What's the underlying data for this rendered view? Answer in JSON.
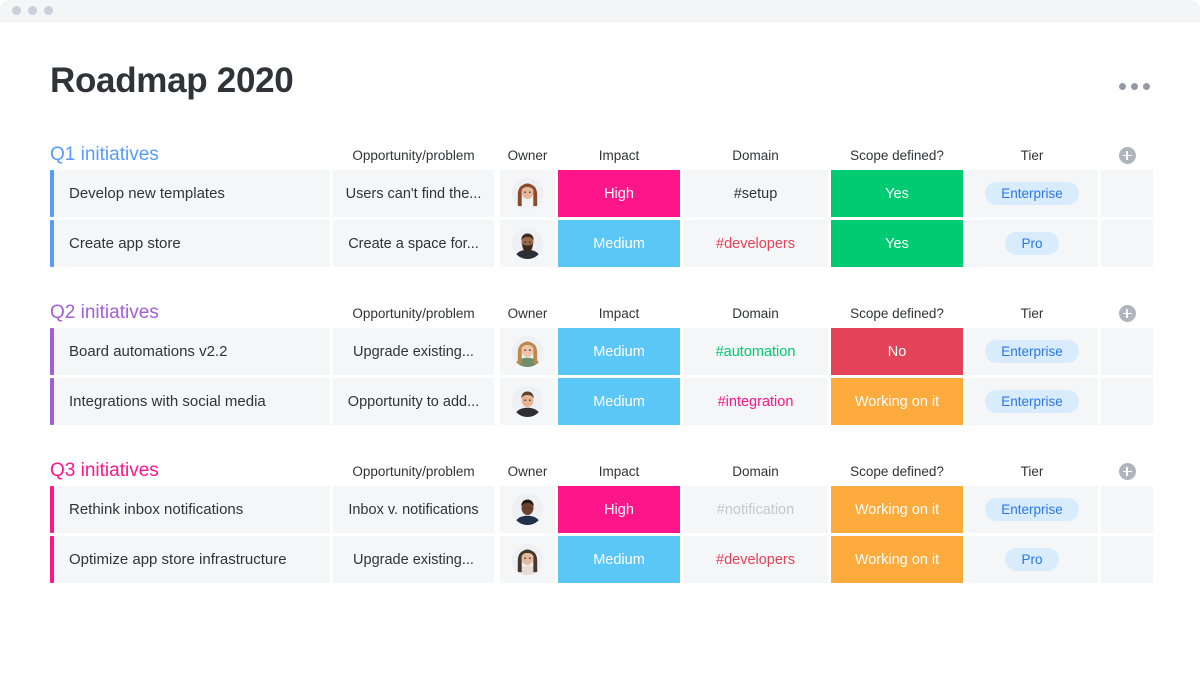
{
  "window": {
    "traffic_lights": [
      "close",
      "minimize",
      "maximize"
    ]
  },
  "header": {
    "title": "Roadmap 2020",
    "more_menu_icon": "kebab-menu-icon"
  },
  "columns": {
    "opportunity": "Opportunity/problem",
    "owner": "Owner",
    "impact": "Impact",
    "domain": "Domain",
    "scope": "Scope defined?",
    "tier": "Tier",
    "add": "add-column-icon"
  },
  "colors": {
    "q1": "#579bfc",
    "q2": "#a25ddc",
    "q3": "#ff158a",
    "high": "#ff158a",
    "medium": "#5ac7f7",
    "yes": "#00ca72",
    "no": "#e44258",
    "working": "#fdab3d",
    "pill_bg": "#d8ecfe",
    "pill_text": "#2b76e5",
    "cell_bg": "#f5f6f8"
  },
  "groups": [
    {
      "title": "Q1 initiatives",
      "color": "#579bfc",
      "rows": [
        {
          "name": "Develop new templates",
          "opportunity": "Users can't find the...",
          "owner_avatar": "avatar-woman-brown-hair",
          "impact": "High",
          "impact_color": "#ff158a",
          "domain": "#setup",
          "domain_color": "#323338",
          "scope": "Yes",
          "scope_color": "#00ca72",
          "tier": "Enterprise"
        },
        {
          "name": "Create app store",
          "opportunity": "Create a space for...",
          "owner_avatar": "avatar-man-beard",
          "impact": "Medium",
          "impact_color": "#5ac7f7",
          "domain": "#developers",
          "domain_color": "#e44258",
          "scope": "Yes",
          "scope_color": "#00ca72",
          "tier": "Pro"
        }
      ]
    },
    {
      "title": "Q2 initiatives",
      "color": "#a25ddc",
      "rows": [
        {
          "name": "Board automations v2.2",
          "opportunity": "Upgrade existing...",
          "owner_avatar": "avatar-woman-blonde-smiling",
          "impact": "Medium",
          "impact_color": "#5ac7f7",
          "domain": "#automation",
          "domain_color": "#00ca72",
          "scope": "No",
          "scope_color": "#e44258",
          "tier": "Enterprise"
        },
        {
          "name": "Integrations with social media",
          "opportunity": "Opportunity to add...",
          "owner_avatar": "avatar-man-short-hair",
          "impact": "Medium",
          "impact_color": "#5ac7f7",
          "domain": "#integration",
          "domain_color": "#ff158a",
          "scope": "Working on it",
          "scope_color": "#fdab3d",
          "tier": "Enterprise"
        }
      ]
    },
    {
      "title": "Q3 initiatives",
      "color": "#ff158a",
      "rows": [
        {
          "name": "Rethink inbox notifications",
          "opportunity": "Inbox v. notifications",
          "owner_avatar": "avatar-man-dark-skin",
          "impact": "High",
          "impact_color": "#ff158a",
          "domain": "#notification",
          "domain_color": "#c5c7d0",
          "scope": "Working on it",
          "scope_color": "#fdab3d",
          "tier": "Enterprise"
        },
        {
          "name": "Optimize app store infrastructure",
          "opportunity": "Upgrade existing...",
          "owner_avatar": "avatar-woman-dark-hair",
          "impact": "Medium",
          "impact_color": "#5ac7f7",
          "domain": "#developers",
          "domain_color": "#e44258",
          "scope": "Working on it",
          "scope_color": "#fdab3d",
          "tier": "Pro"
        }
      ]
    }
  ]
}
